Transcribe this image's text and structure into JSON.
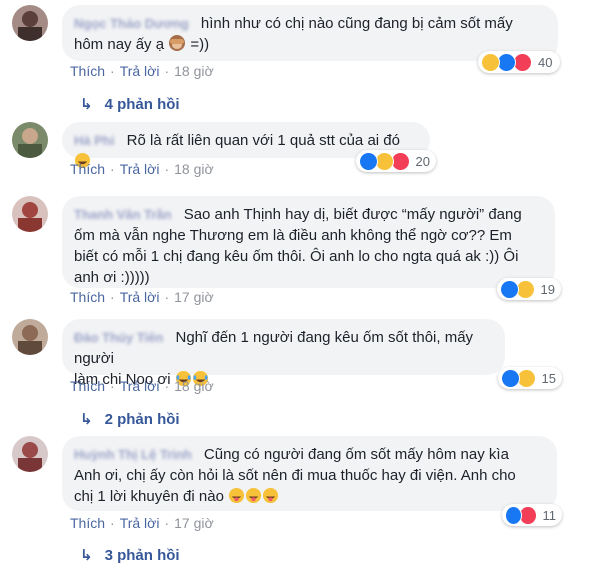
{
  "labels": {
    "like": "Thích",
    "reply": "Trả lời",
    "sep": "·"
  },
  "comments": [
    {
      "author": "Ngọc Thảo Dương",
      "text_lines": [
        "hình như có chị nào cũng đang bị cảm sốt mấy",
        "hôm nay ấy ạ",
        " =))"
      ],
      "time": "18 giờ",
      "reaction_count": "40",
      "replies_label": "4 phản hồi"
    },
    {
      "author": "Hà Phi",
      "text": "Rõ là rất liên quan với 1 quả stt của ai đó",
      "time": "18 giờ",
      "reaction_count": "20"
    },
    {
      "author": "Thanh Vân Trần",
      "text_lines": [
        "Sao anh Thịnh hay dị, biết được “mấy người” đang",
        "ốm mà vẫn nghe Thương em là điều anh không thể ngờ cơ?? Em",
        "biết có mỗi 1 chị đang kêu ốm thôi. Ôi anh lo cho ngta quá ak :)) Ôi",
        "anh ơi :)))))"
      ],
      "time": "17 giờ",
      "reaction_count": "19"
    },
    {
      "author": "Đào Thúy Tiên",
      "text_lines": [
        "Nghĩ đến 1 người đang kêu ốm sốt thôi, mấy người",
        "làm chi Noo ơi"
      ],
      "time": "18 giờ",
      "reaction_count": "15",
      "replies_label": "2 phản hồi"
    },
    {
      "author": "Huỳnh Thị Lệ Trinh",
      "text_lines": [
        "Cũng có người đang ốm sốt mấy hôm nay kìa",
        "Anh ơi, chị ấy còn hỏi là sốt nên đi mua thuốc hay đi viện. Anh cho",
        "chị 1 lời khuyên đi nào"
      ],
      "time": "17 giờ",
      "reaction_count": "11",
      "replies_label": "3 phản hồi"
    }
  ],
  "colors": {
    "link": "#4b67a1",
    "bubble": "#f2f3f5",
    "like": "#1877f2",
    "haha": "#f7c23a",
    "love": "#f33e58"
  }
}
